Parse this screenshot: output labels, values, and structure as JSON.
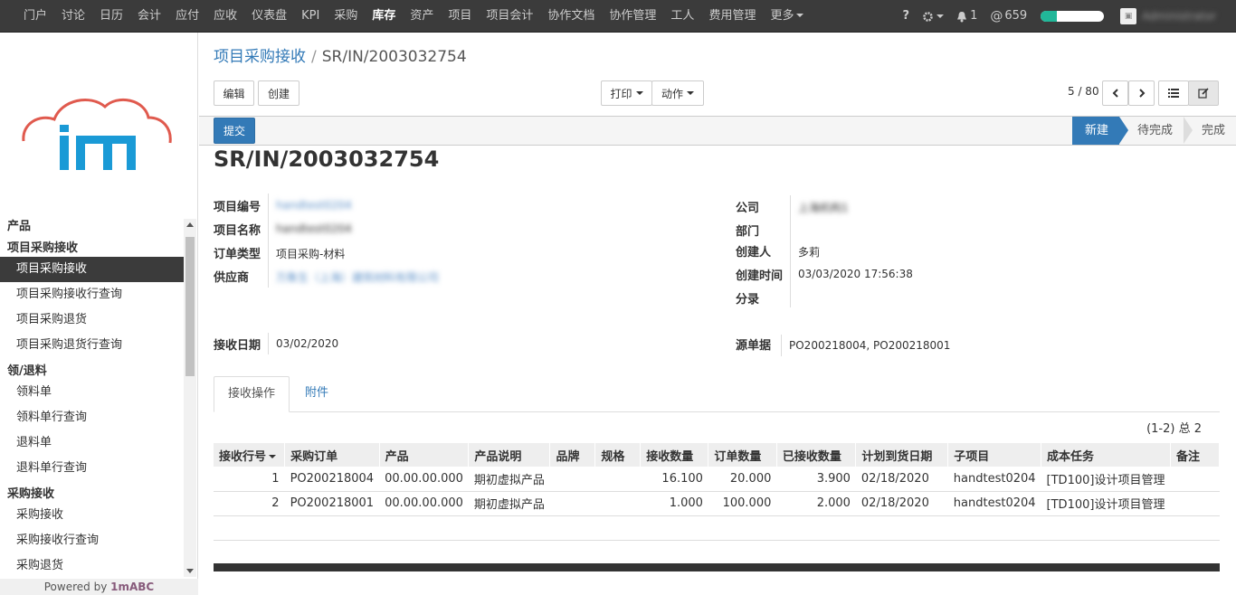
{
  "topnav": {
    "items": [
      "门户",
      "讨论",
      "日历",
      "会计",
      "应付",
      "应收",
      "仪表盘",
      "KPI",
      "采购",
      "库存",
      "资产",
      "项目",
      "项目会计",
      "协作文档",
      "协作管理",
      "工人",
      "费用管理"
    ],
    "active": "库存",
    "more_label": "更多",
    "help": "?",
    "notif_count": "1",
    "at_count": "659",
    "progress_value": 0.25,
    "user_name": "Administrator"
  },
  "sidebar": {
    "logo_text": "im",
    "sections": [
      {
        "heading": "产品",
        "items": []
      },
      {
        "heading": "项目采购接收",
        "items": [
          "项目采购接收",
          "项目采购接收行查询",
          "项目采购退货",
          "项目采购退货行查询"
        ]
      },
      {
        "heading": "领/退料",
        "items": [
          "领料单",
          "领料单行查询",
          "退料单",
          "退料单行查询"
        ]
      },
      {
        "heading": "采购接收",
        "items": [
          "采购接收",
          "采购接收行查询",
          "采购退货"
        ]
      }
    ],
    "active_item": "项目采购接收",
    "powered_prefix": "Powered by",
    "powered_brand": "1mABC"
  },
  "breadcrumb": {
    "parent": "项目采购接收",
    "separator": "/",
    "current": "SR/IN/2003032754"
  },
  "toolbar": {
    "edit": "编辑",
    "create": "创建",
    "print": "打印",
    "action": "动作",
    "pager": "5 / 80"
  },
  "statusbar": {
    "submit": "提交",
    "stages": [
      "新建",
      "待完成",
      "完成"
    ],
    "current_stage": "新建"
  },
  "record": {
    "title": "SR/IN/2003032754",
    "left_fields": [
      {
        "label": "项目编号",
        "value": "handtest0204"
      },
      {
        "label": "项目名称",
        "value": "handtest0204"
      },
      {
        "label": "订单类型",
        "value": "项目采购-材料"
      },
      {
        "label": "供应商",
        "value": "万象生（上海）建筑材料有限公司"
      }
    ],
    "right_fields": [
      {
        "label": "公司",
        "value": "上海机构1"
      },
      {
        "label": "部门",
        "value": ""
      },
      {
        "label": "创建人",
        "value": "多莉"
      },
      {
        "label": "创建时间",
        "value": "03/03/2020 17:56:38"
      },
      {
        "label": "分录",
        "value": ""
      }
    ],
    "receive_date_label": "接收日期",
    "receive_date": "03/02/2020",
    "source_label": "源单据",
    "source": "PO200218004, PO200218001"
  },
  "tabs": [
    "接收操作",
    "附件"
  ],
  "table": {
    "count": "(1-2) 总 2",
    "headers": [
      "接收行号",
      "采购订单",
      "产品",
      "产品说明",
      "品牌",
      "规格",
      "接收数量",
      "订单数量",
      "已接收数量",
      "计划到货日期",
      "子项目",
      "成本任务",
      "备注"
    ],
    "rows": [
      [
        "1",
        "PO200218004",
        "00.00.00.000",
        "期初虚拟产品",
        "",
        "",
        "16.100",
        "20.000",
        "3.900",
        "02/18/2020",
        "handtest0204",
        "[TD100]设计项目管理",
        ""
      ],
      [
        "2",
        "PO200218001",
        "00.00.00.000",
        "期初虚拟产品",
        "",
        "",
        "1.000",
        "100.000",
        "2.000",
        "02/18/2020",
        "handtest0204",
        "[TD100]设计项目管理",
        ""
      ]
    ]
  }
}
